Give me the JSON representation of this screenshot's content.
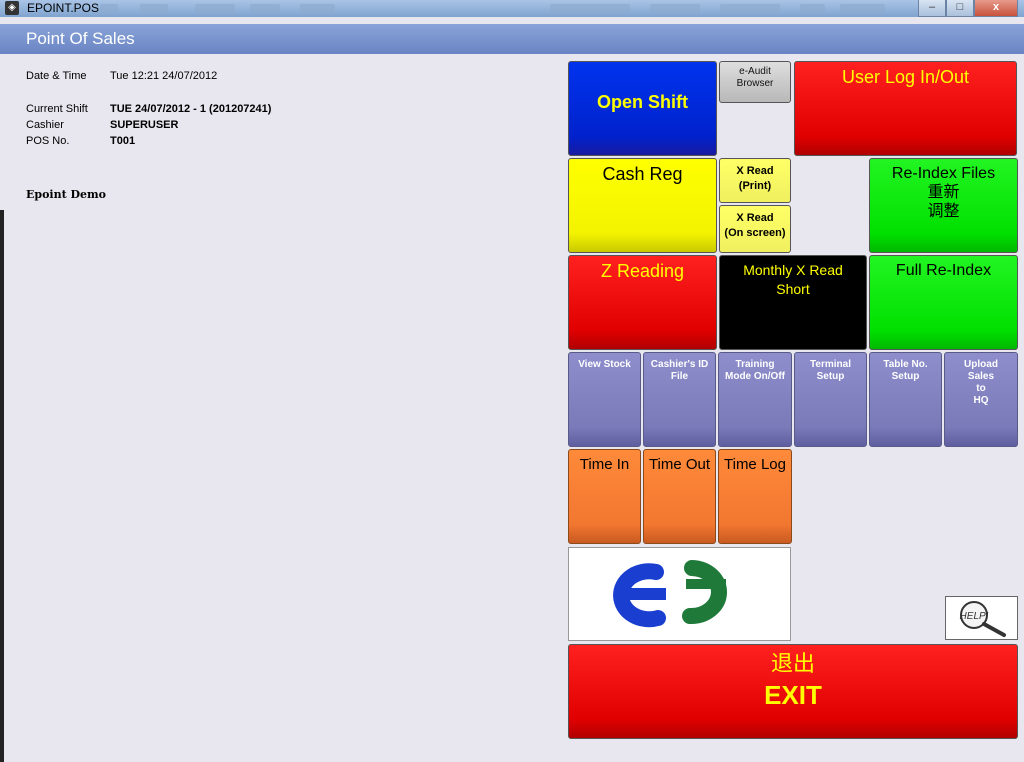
{
  "window": {
    "title": "EPOINT.POS",
    "minimize": "–",
    "maximize": "□",
    "close": "x"
  },
  "header": {
    "title": "Point Of Sales"
  },
  "info": {
    "datetime_label": "Date & Time",
    "datetime_value": "Tue 12:21 24/07/2012",
    "shift_label": "Current Shift",
    "shift_value": "TUE 24/07/2012 - 1  (201207241)",
    "cashier_label": "Cashier",
    "cashier_value": "SUPERUSER",
    "pos_label": "POS No.",
    "pos_value": "T001",
    "company": "Epoint Demo"
  },
  "buttons": {
    "open_shift": [
      "Open Shift"
    ],
    "eaudit": [
      "e-Audit",
      "Browser"
    ],
    "user_log": [
      "User Log In/Out"
    ],
    "cash_reg": [
      "Cash Reg"
    ],
    "xread_print": [
      "X Read",
      "(Print)"
    ],
    "xread_screen": [
      "X Read",
      "(On screen)"
    ],
    "reindex_files": [
      "Re-Index Files",
      "重新",
      "调整"
    ],
    "z_reading": [
      "Z Reading"
    ],
    "monthly_x": [
      "Monthly X Read",
      "Short"
    ],
    "full_reindex": [
      "Full Re-Index"
    ],
    "view_stock": [
      "View Stock"
    ],
    "cashier_id": [
      "Cashier's ID",
      "File"
    ],
    "training": [
      "Training",
      "Mode On/Off"
    ],
    "terminal_setup": [
      "Terminal",
      "Setup"
    ],
    "table_setup": [
      "Table No.",
      "Setup"
    ],
    "upload_sales": [
      "Upload",
      "Sales",
      "to",
      "HQ"
    ],
    "time_in": [
      "Time In"
    ],
    "time_out": [
      "Time Out"
    ],
    "time_log": [
      "Time Log"
    ],
    "exit": [
      "退出",
      "EXIT"
    ],
    "help": "HELP!"
  },
  "colors": {
    "logo_blue": "#1a3fd0",
    "logo_green": "#1f7a3a",
    "exit_text": "#ffff00"
  }
}
